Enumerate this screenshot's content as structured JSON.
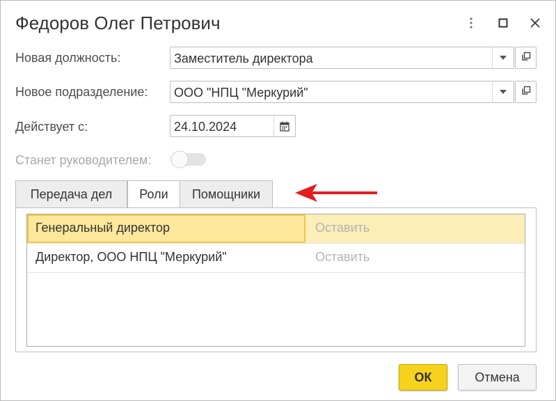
{
  "window": {
    "title": "Федоров Олег Петрович"
  },
  "header_buttons": {
    "more": "more-vertical-icon",
    "maximize": "maximize-icon",
    "close": "close-icon"
  },
  "form": {
    "position": {
      "label": "Новая должность:",
      "value": "Заместитель директора"
    },
    "department": {
      "label": "Новое подразделение:",
      "value": "ООО \"НПЦ \"Меркурий\""
    },
    "effective_date": {
      "label": "Действует с:",
      "value": "24.10.2024"
    },
    "becomes_head": {
      "label": "Станет руководителем:",
      "enabled": false,
      "checked": false
    }
  },
  "tabs": [
    {
      "label": "Передача дел",
      "active": false
    },
    {
      "label": "Роли",
      "active": true
    },
    {
      "label": "Помощники",
      "active": false
    }
  ],
  "roles_table": {
    "rows": [
      {
        "role": "Генеральный директор",
        "action": "Оставить",
        "selected": true
      },
      {
        "role": "Директор, ООО НПЦ \"Меркурий\"",
        "action": "Оставить",
        "selected": false
      }
    ]
  },
  "buttons": {
    "ok": "ОК",
    "cancel": "Отмена"
  },
  "colors": {
    "accent_yellow": "#f7d21d",
    "selection": "#fbeeb7",
    "arrow": "#e31e1e"
  }
}
